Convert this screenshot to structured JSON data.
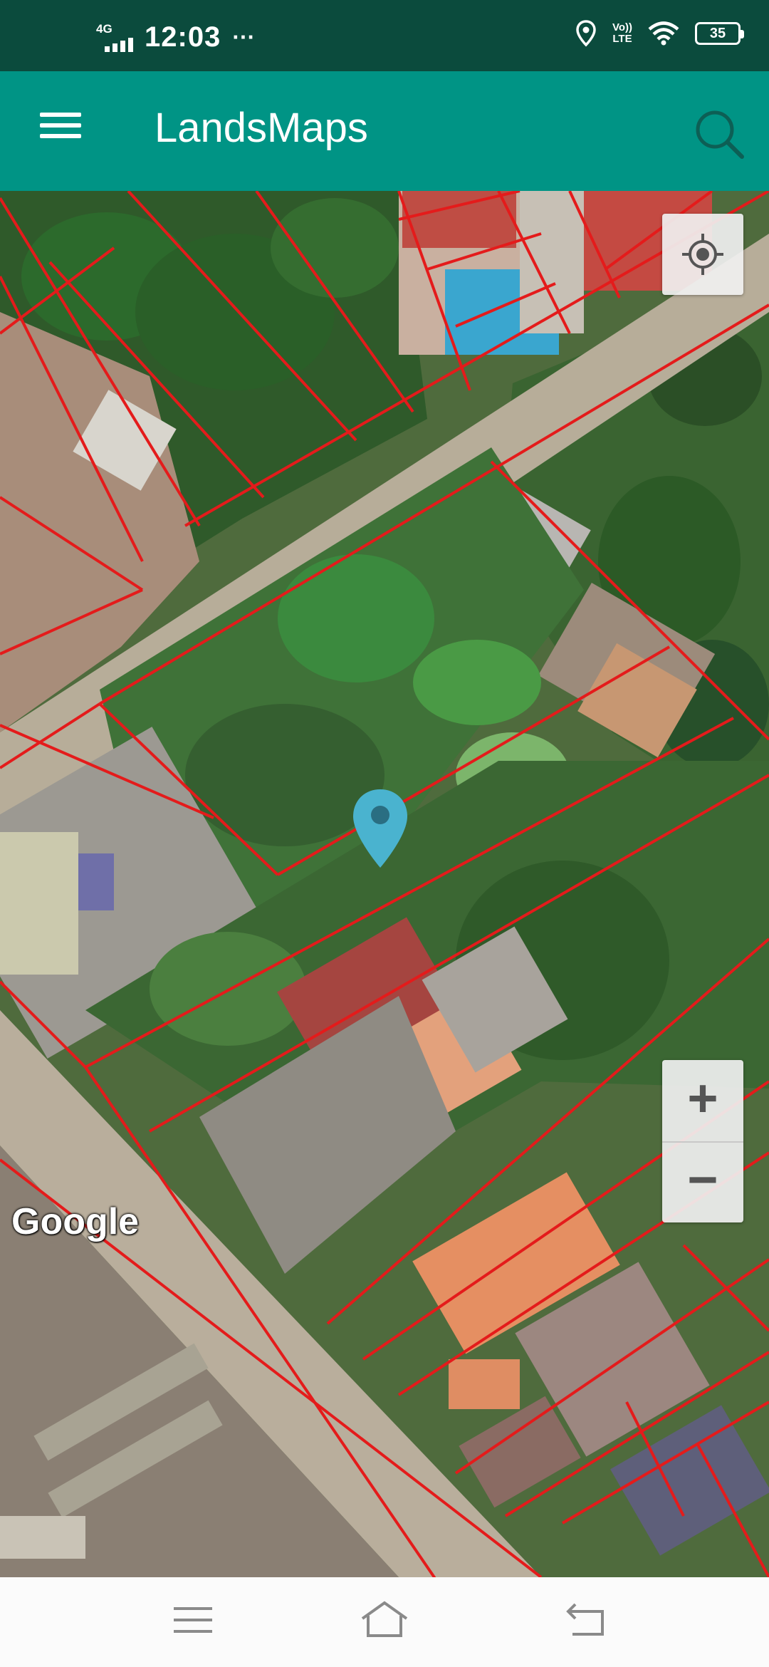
{
  "status_bar": {
    "network": "4G",
    "time": "12:03",
    "more": "···",
    "lte_label_top": "Vo))",
    "lte_label_bottom": "LTE",
    "battery": "35"
  },
  "app_bar": {
    "title": "LandsMaps",
    "menu_icon": "hamburger-menu-icon",
    "search_icon": "search-icon"
  },
  "map": {
    "view": "satellite",
    "parcel_line_color": "#e41b1b",
    "locate_icon": "my-location-icon",
    "zoom_in_label": "+",
    "zoom_out_label": "−",
    "attribution": "Google",
    "marker_icon": "location-pin-icon",
    "marker_color": "#4ab3cf"
  },
  "nav_bar": {
    "menu_icon": "menu-lines-icon",
    "home_icon": "home-icon",
    "back_icon": "back-icon"
  }
}
